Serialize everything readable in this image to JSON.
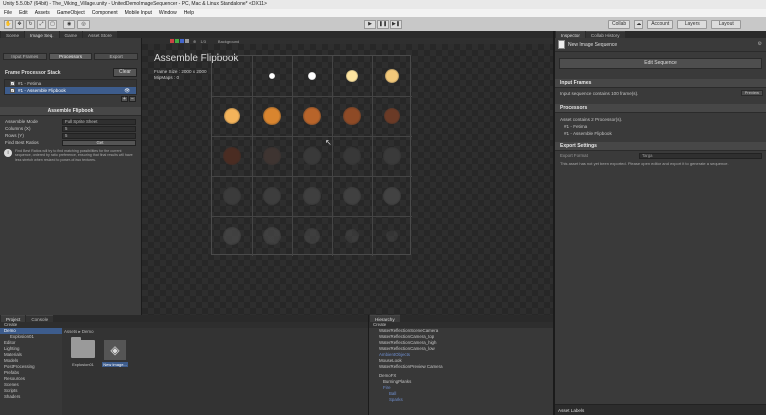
{
  "window": {
    "title": "Unity 5.5.0b7 (64bit) - The_Viking_Village.unity - UnitedDemoImageSequencer - PC, Mac & Linux Standalone* <DX11>"
  },
  "menu": [
    "File",
    "Edit",
    "Assets",
    "GameObject",
    "Component",
    "Mobile Input",
    "Window",
    "Help"
  ],
  "toolbar": {
    "collab": "Collab",
    "account": "Account",
    "layers": "Layers",
    "layout": "Layout",
    "play": "▶",
    "pause": "❚❚",
    "step": "▶❚"
  },
  "tabs_left": [
    "Scene",
    "Image Seq.",
    "Game",
    "Asset Store"
  ],
  "processor_tabs": [
    "Input Frames",
    "Processors",
    "Export"
  ],
  "frame_stack": {
    "title": "Frame Processor Stack",
    "clear": "Clear",
    "items": [
      "#1 - Fetima",
      "#1 - Assemble Flipbook"
    ]
  },
  "assemble": {
    "title": "Assemble Flipbook",
    "mode_label": "Assemble Mode",
    "mode_value": "Full Sprite Sheet",
    "columns_label": "Columns (X)",
    "columns_value": "5",
    "rows_label": "Rows (Y)",
    "rows_value": "5",
    "best_label": "Find Best Ratios",
    "best_button": "Get",
    "info": "Find Best Ratios will try to find matching possibilities for the current sequence, ordered by ratio preference, ensuring that final results will have less stretch when resized to power-of-two textures."
  },
  "viewport": {
    "zoom": "1/3",
    "background": "Background",
    "title": "Assemble Flipbook",
    "size": "Frame Size : 2000 x 2000",
    "mipmaps": "MipMaps : 0"
  },
  "inspector": {
    "tabs": [
      "Inspector",
      "Collab History"
    ],
    "asset": "New Image Sequence",
    "edit_button": "Edit Sequence",
    "input_title": "Input Frames",
    "input_text": "Input sequence contains 100 frame(s).",
    "preview": "Preview",
    "processors_title": "Processors",
    "processors_text": "Asset contains 2 Processor(s).",
    "processor_items": [
      "#1 - Fetima",
      "#1 - Assemble Flipbook"
    ],
    "export_title": "Export Settings",
    "export_label": "Export Format",
    "export_value": "Targa",
    "export_note": "This asset has not yet been exported. Please open editor and export it to generate a sequence.",
    "labels": "Asset Labels"
  },
  "project": {
    "tabs": [
      "Project",
      "Console"
    ],
    "create": "Create",
    "breadcrumb": "Assets ▸ Demo",
    "tree": [
      "Demo",
      "Explosion01",
      "Editor",
      "Lighting",
      "Materials",
      "Models",
      "PostProcessing",
      "Prefabs",
      "Resources",
      "Scenes",
      "Scripts",
      "Shaders"
    ],
    "assets": [
      {
        "name": "Explosion01",
        "kind": "folder"
      },
      {
        "name": "New Image...",
        "kind": "unity"
      }
    ]
  },
  "hierarchy": {
    "tab": "Hierarchy",
    "create": "Create",
    "items": [
      "WaterReflectionSceneCamera",
      "WaterReflectionCamera_top",
      "WaterReflectionCamera_high",
      "WaterReflectionCamera_low",
      "AmbientObjects",
      "MouseLook",
      "WaterReflectionPreview Camera",
      "DemoFX",
      "BurningPlanks",
      "Fire",
      "Ball",
      "Sparks"
    ]
  },
  "colors": {
    "bg": "#1b1b1b",
    "panel": "#3a3a3a",
    "accent": "#3d5c8c",
    "checker_a": "#2c2c2c",
    "checker_b": "#333333"
  }
}
